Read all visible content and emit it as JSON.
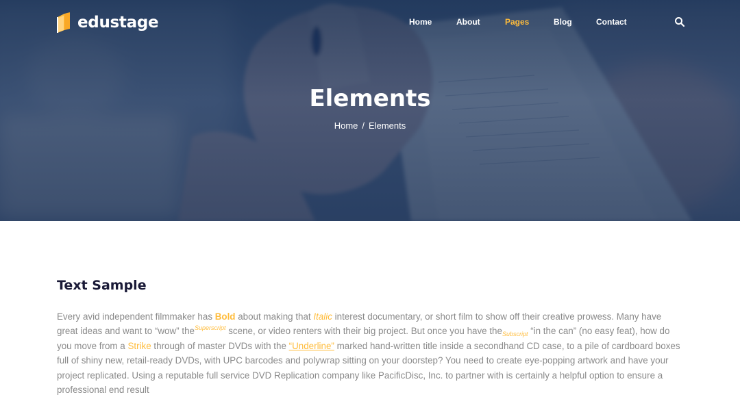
{
  "header": {
    "logo_text": "edustage",
    "nav": [
      {
        "label": "Home",
        "active": false
      },
      {
        "label": "About",
        "active": false
      },
      {
        "label": "Pages",
        "active": true
      },
      {
        "label": "Blog",
        "active": false
      },
      {
        "label": "Contact",
        "active": false
      }
    ],
    "search_icon": "search-icon"
  },
  "hero": {
    "title": "Elements",
    "breadcrumb": {
      "home": "Home",
      "separator": "/",
      "current": "Elements"
    }
  },
  "text_sample": {
    "heading": "Text Sample",
    "p1": "Every avid independent filmmaker has ",
    "bold": "Bold",
    "p2": " about making that ",
    "italic": "Italic",
    "p3": " interest documentary, or short film to show off their creative prowess. Many have great ideas and want to “wow” the",
    "superscript": "Superscript",
    "p4": " scene, or video renters with their big project. But once you have the",
    "subscript": "Subscript",
    "p5": " “in the can” (no easy feat), how do you move from a ",
    "strike": "Strike",
    "p6": " through of master DVDs with the ",
    "underline": "“Underline”",
    "p7": " marked hand-written title inside a secondhand CD case, to a pile of cardboard boxes full of shiny new, retail-ready DVDs, with UPC barcodes and polywrap sitting on your doorstep? You need to create eye-popping artwork and have your project replicated. Using a reputable full service DVD Replication company like PacificDisc, Inc. to partner with is certainly a helpful option to ensure a professional end result"
  },
  "colors": {
    "accent": "#ffbc3b",
    "hero_overlay": "#1f3658",
    "heading": "#1a1a37",
    "body_text": "#8a8a8a"
  }
}
